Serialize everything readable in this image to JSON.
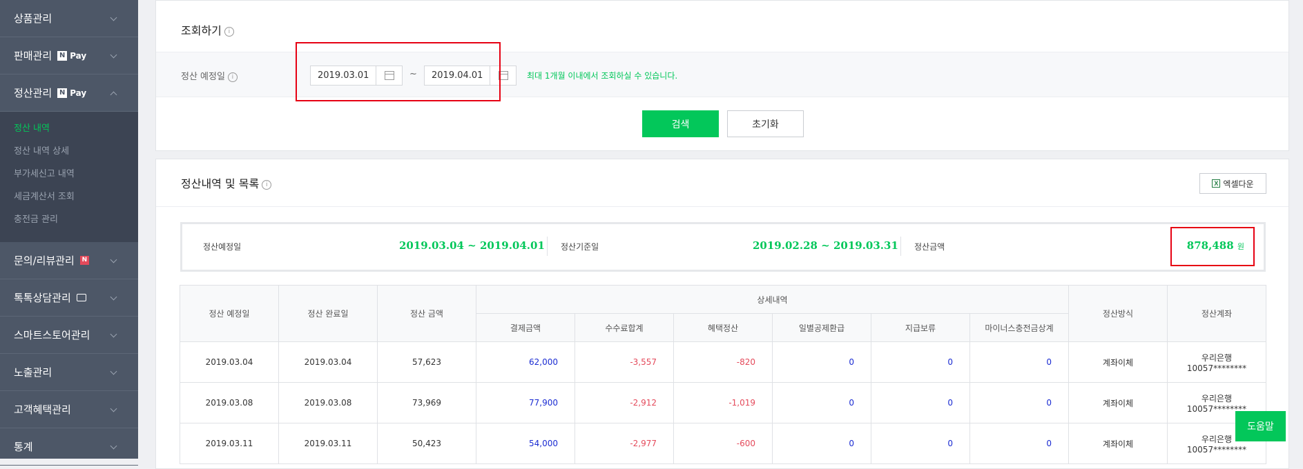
{
  "sidebar": {
    "items": [
      {
        "label": "상품관리"
      },
      {
        "label": "판매관리",
        "badge": "Pay"
      },
      {
        "label": "정산관리",
        "badge": "Pay"
      },
      {
        "label": "문의/리뷰관리"
      },
      {
        "label": "톡톡상담관리"
      },
      {
        "label": "스마트스토어관리"
      },
      {
        "label": "노출관리"
      },
      {
        "label": "고객혜택관리"
      },
      {
        "label": "통계"
      }
    ],
    "submenu": [
      "정산 내역",
      "정산 내역 상세",
      "부가세신고 내역",
      "세금계산서 조회",
      "충전금 관리"
    ],
    "npay_n": "N",
    "new_badge": "N"
  },
  "search_panel": {
    "title": "조회하기",
    "field_label": "정산 예정일",
    "start_date": "2019.03.01",
    "end_date": "2019.04.01",
    "separator": "~",
    "hint": "최대 1개월 이내에서 조회하실 수 있습니다.",
    "search_button": "검색",
    "reset_button": "초기화"
  },
  "result_panel": {
    "title": "정산내역 및 목록",
    "excel_button": "엑셀다운",
    "summary": {
      "expected_label": "정산예정일",
      "expected_range": "2019.03.04 ~ 2019.04.01",
      "base_label": "정산기준일",
      "base_range": "2019.02.28 ~ 2019.03.31",
      "amount_label": "정산금액",
      "amount_value": "878,488",
      "amount_unit": "원"
    },
    "table": {
      "headers": {
        "expected_date": "정산 예정일",
        "complete_date": "정산 완료일",
        "amount": "정산 금액",
        "detail": "상세내역",
        "method": "정산방식",
        "account": "정산계좌"
      },
      "sub_headers": [
        "결제금액",
        "수수료합계",
        "혜택정산",
        "일별공제환급",
        "지급보류",
        "마이너스충전금상계"
      ],
      "rows": [
        {
          "expected": "2019.03.04",
          "complete": "2019.03.04",
          "amount": "57,623",
          "payment": "62,000",
          "fee": "-3,557",
          "benefit": "-820",
          "refund": "0",
          "hold": "0",
          "minus": "0",
          "method": "계좌이체",
          "bank": "우리은행",
          "account_no": "10057********"
        },
        {
          "expected": "2019.03.08",
          "complete": "2019.03.08",
          "amount": "73,969",
          "payment": "77,900",
          "fee": "-2,912",
          "benefit": "-1,019",
          "refund": "0",
          "hold": "0",
          "minus": "0",
          "method": "계좌이체",
          "bank": "우리은행",
          "account_no": "10057********"
        },
        {
          "expected": "2019.03.11",
          "complete": "2019.03.11",
          "amount": "50,423",
          "payment": "54,000",
          "fee": "-2,977",
          "benefit": "-600",
          "refund": "0",
          "hold": "0",
          "minus": "0",
          "method": "계좌이체",
          "bank": "우리은행",
          "account_no": "10057********"
        }
      ]
    }
  },
  "help_button": "도움말",
  "colors": {
    "accent": "#03c75a",
    "sidebar": "#4d5767",
    "highlight": "#e60012"
  }
}
